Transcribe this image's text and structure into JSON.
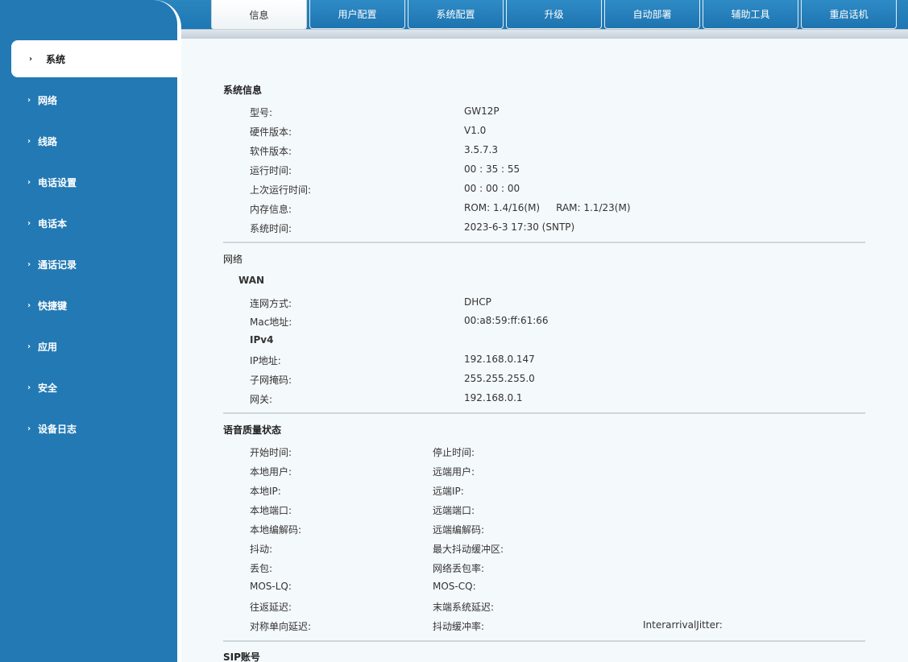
{
  "tabs": [
    "信息",
    "用户配置",
    "系统配置",
    "升级",
    "自动部署",
    "辅助工具",
    "重启话机"
  ],
  "active_tab": "信息",
  "sidebar": {
    "items": [
      "系统",
      "网络",
      "线路",
      "电话设置",
      "电话本",
      "通话记录",
      "快捷键",
      "应用",
      "安全",
      "设备日志"
    ],
    "active": "系统"
  },
  "system_info": {
    "title": "系统信息",
    "model_label": "型号:",
    "model": "GW12P",
    "hw_label": "硬件版本:",
    "hw": "V1.0",
    "sw_label": "软件版本:",
    "sw": "3.5.7.3",
    "uptime_label": "运行时间:",
    "uptime": "00 : 35 : 55",
    "last_uptime_label": "上次运行时间:",
    "last_uptime": "00 : 00 : 00",
    "memory_label": "内存信息:",
    "rom": "ROM: 1.4/16(M)",
    "ram": "RAM: 1.1/23(M)",
    "systime_label": "系统时间:",
    "systime": "2023-6-3 17:30 (SNTP)"
  },
  "network": {
    "title": "网络",
    "wan_title": "WAN",
    "mode_label": "连网方式:",
    "mode": "DHCP",
    "mac_label": "Mac地址:",
    "mac": "00:a8:59:ff:61:66",
    "ipv4_title": "IPv4",
    "ip_label": "IP地址:",
    "ip": "192.168.0.147",
    "mask_label": "子网掩码:",
    "mask": "255.255.255.0",
    "gw_label": "网关:",
    "gw": "192.168.0.1"
  },
  "voice": {
    "title": "语音质量状态",
    "rows": [
      [
        "开始时间:",
        "停止时间:",
        ""
      ],
      [
        "本地用户:",
        "远端用户:",
        ""
      ],
      [
        "本地IP:",
        "远端IP:",
        ""
      ],
      [
        "本地端口:",
        "远端端口:",
        ""
      ],
      [
        "本地编解码:",
        "远端编解码:",
        ""
      ],
      [
        "抖动:",
        "最大抖动缓冲区:",
        ""
      ],
      [
        "丢包:",
        "网络丢包率:",
        ""
      ],
      [
        "MOS-LQ:",
        "MOS-CQ:",
        ""
      ],
      [
        "往返延迟:",
        "末端系统延迟:",
        ""
      ],
      [
        "对称单向延迟:",
        "抖动缓冲率:",
        "InterarrivalJitter:"
      ]
    ]
  },
  "sip": {
    "title": "SIP账号"
  }
}
